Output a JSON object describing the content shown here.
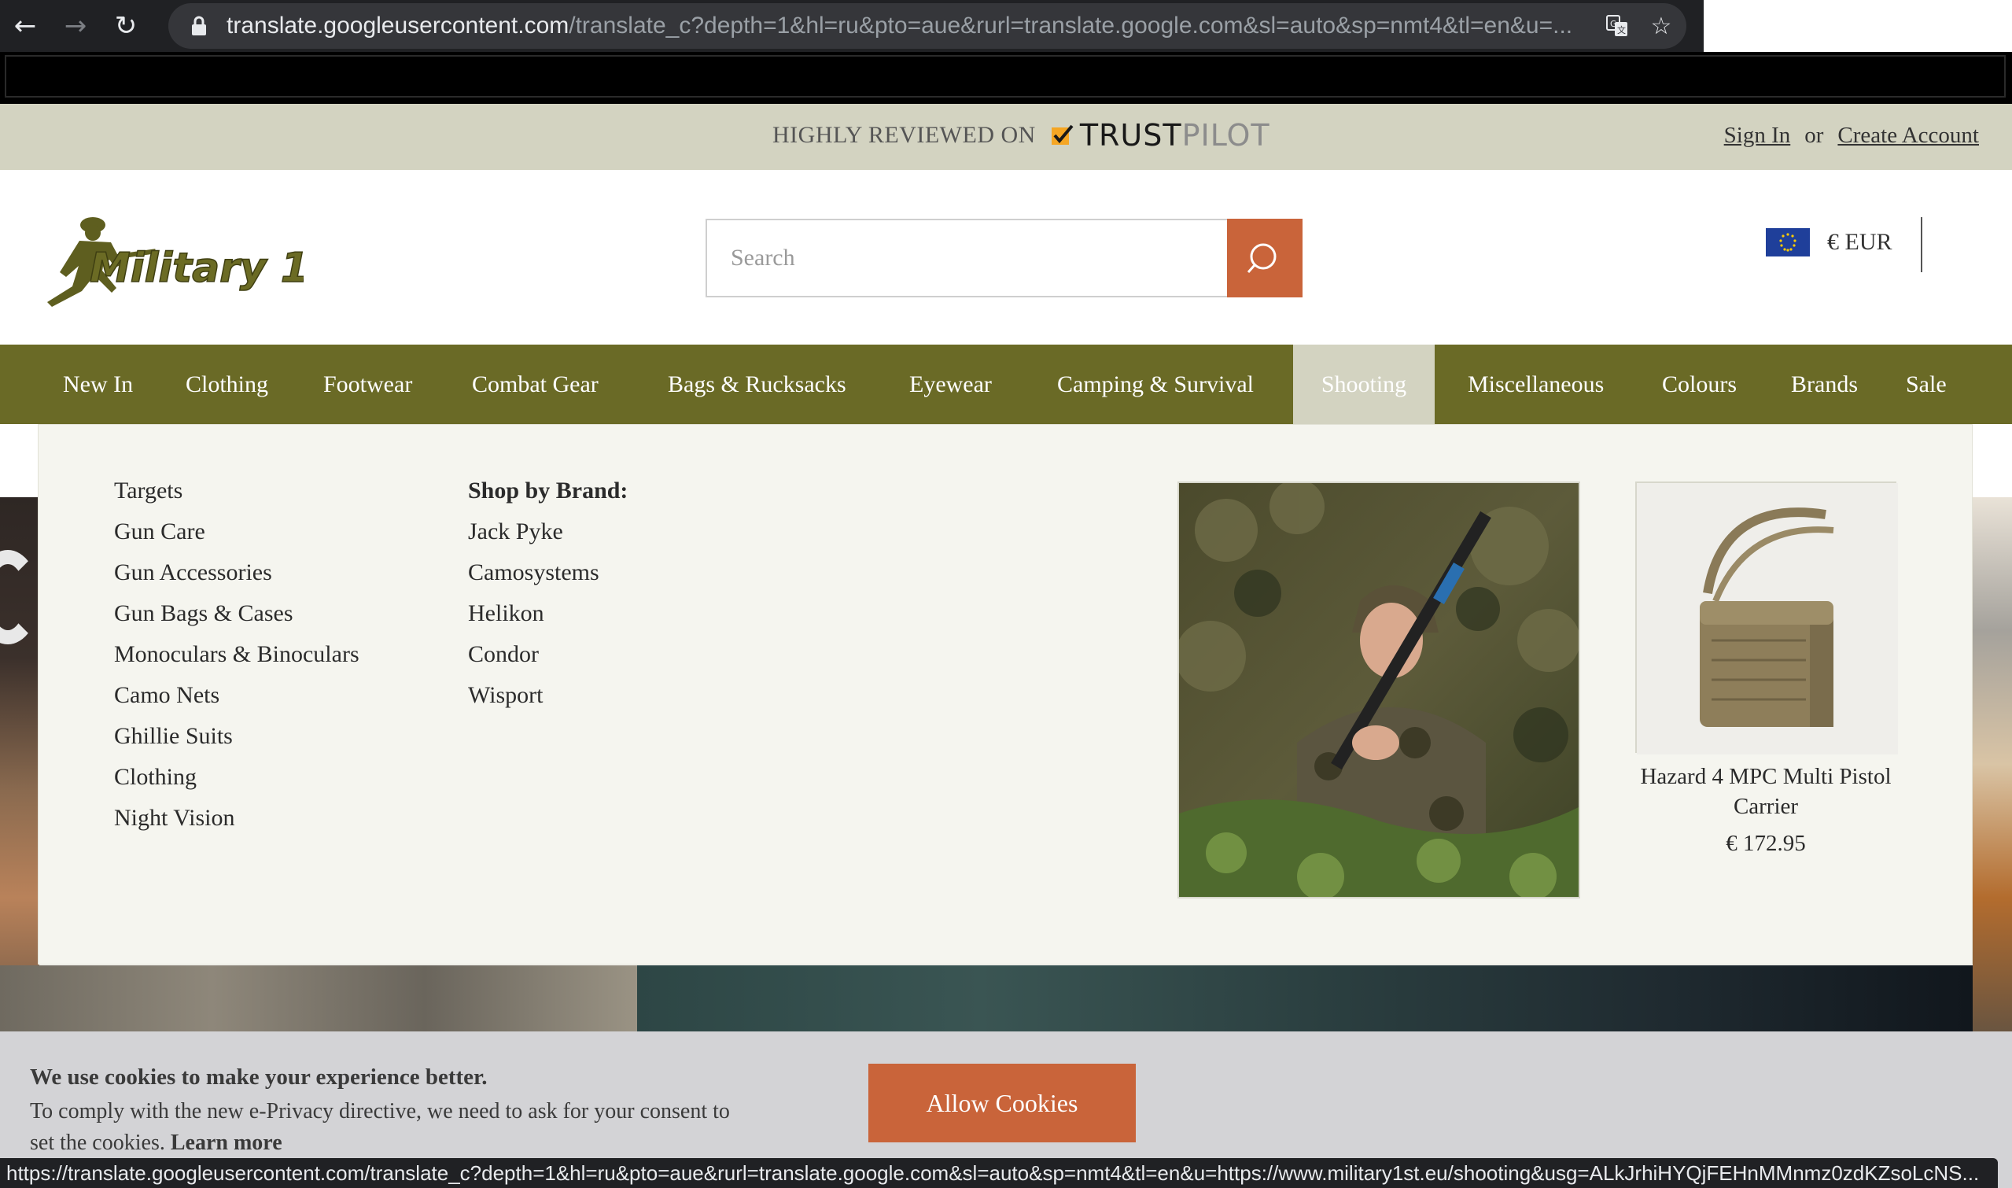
{
  "browser": {
    "url_host": "translate.googleusercontent.com",
    "url_path": "/translate_c?depth=1&hl=ru&pto=aue&rurl=translate.google.com&sl=auto&sp=nmt4&tl=en&u=...",
    "status_url": "https://translate.googleusercontent.com/translate_c?depth=1&hl=ru&pto=aue&rurl=translate.google.com&sl=auto&sp=nmt4&tl=en&u=https://www.military1st.eu/shooting&usg=ALkJrhiHYQjFEHnMMnmz0zdKZsoLcNS..."
  },
  "topbar": {
    "reviewed_text": "HIGHLY REVIEWED ON",
    "trust": "TRUST",
    "pilot": "PILOT",
    "sign_in": "Sign In",
    "or": "or",
    "create_account": "Create Account"
  },
  "header": {
    "logo_text": "Military 1st",
    "search_placeholder": "Search",
    "currency": "€ EUR"
  },
  "nav": {
    "items": [
      "New In",
      "Clothing",
      "Footwear",
      "Combat Gear",
      "Bags & Rucksacks",
      "Eyewear",
      "Camping & Survival",
      "Shooting",
      "Miscellaneous",
      "Colours",
      "Brands",
      "Sale"
    ],
    "active": "Shooting"
  },
  "dropdown": {
    "categories": [
      "Targets",
      "Gun Care",
      "Gun Accessories",
      "Gun Bags & Cases",
      "Monoculars & Binoculars",
      "Camo Nets",
      "Ghillie Suits",
      "Clothing",
      "Night Vision"
    ],
    "brand_heading": "Shop by Brand:",
    "brands": [
      "Jack Pyke",
      "Camosystems",
      "Helikon",
      "Condor",
      "Wisport"
    ],
    "product": {
      "name": "Hazard 4 MPC Multi Pistol Carrier",
      "price": "€ 172.95"
    }
  },
  "cookie": {
    "title": "We use cookies to make your experience better.",
    "text": "To comply with the new e-Privacy directive, we need to ask for your consent to set the cookies.",
    "learn_more": "Learn more",
    "button": "Allow Cookies"
  },
  "colors": {
    "nav_bg": "#6a6a26",
    "accent": "#c9643a",
    "topbar_bg": "#d3d3c1"
  }
}
